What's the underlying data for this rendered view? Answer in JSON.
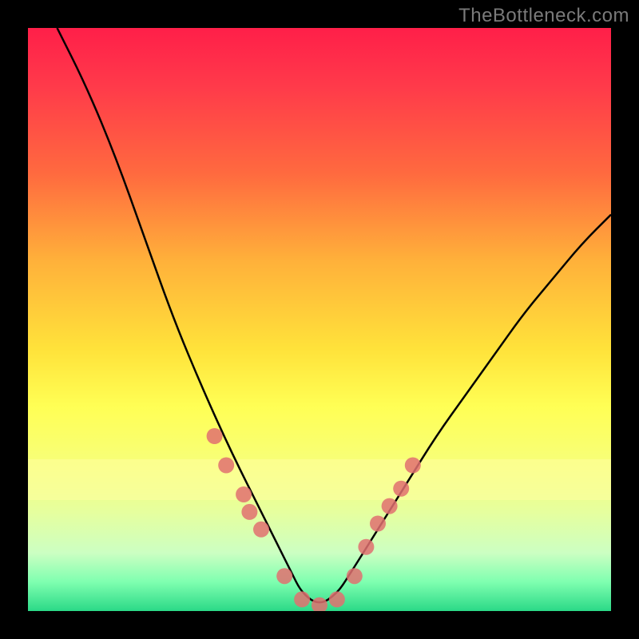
{
  "attribution": "TheBottleneck.com",
  "chart_data": {
    "type": "line",
    "title": "",
    "xlabel": "",
    "ylabel": "",
    "xlim": [
      0,
      100
    ],
    "ylim": [
      0,
      100
    ],
    "series": [
      {
        "name": "bottleneck-curve",
        "x": [
          5,
          10,
          15,
          20,
          25,
          30,
          35,
          40,
          45,
          47,
          50,
          53,
          55,
          60,
          65,
          70,
          75,
          80,
          85,
          90,
          95,
          100
        ],
        "y": [
          100,
          90,
          78,
          64,
          50,
          38,
          27,
          17,
          7,
          3,
          1,
          3,
          6,
          14,
          22,
          30,
          37,
          44,
          51,
          57,
          63,
          68
        ]
      }
    ],
    "markers": {
      "name": "highlight-points",
      "color": "#e07070",
      "x": [
        32,
        34,
        37,
        38,
        40,
        44,
        47,
        50,
        53,
        56,
        58,
        60,
        62,
        64,
        66
      ],
      "y": [
        30,
        25,
        20,
        17,
        14,
        6,
        2,
        1,
        2,
        6,
        11,
        15,
        18,
        21,
        25
      ]
    },
    "background_gradient": {
      "top": "#ff1f49",
      "mid": "#ffde3a",
      "bottom": "#2bd987"
    }
  }
}
